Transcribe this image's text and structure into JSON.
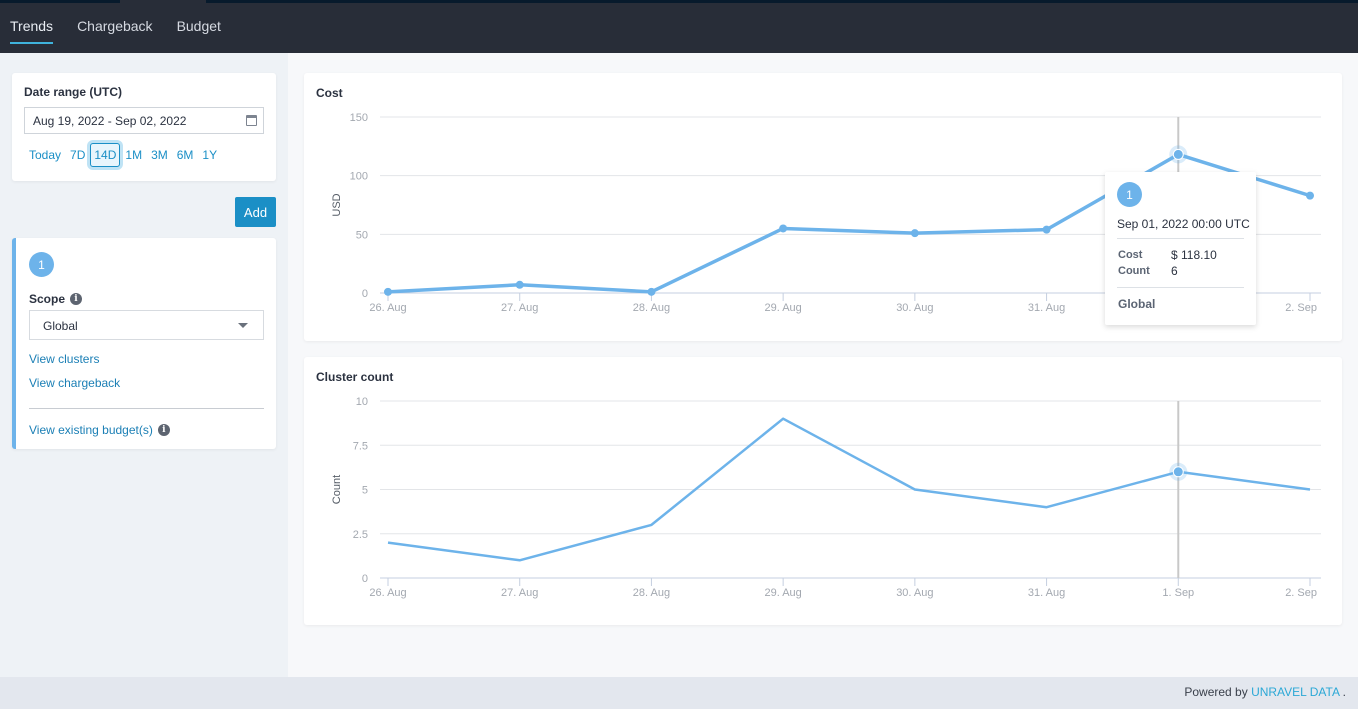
{
  "nav": {
    "tabs": [
      {
        "label": "Trends",
        "active": true
      },
      {
        "label": "Chargeback",
        "active": false
      },
      {
        "label": "Budget",
        "active": false
      }
    ]
  },
  "date_range": {
    "label": "Date range (UTC)",
    "value": "Aug 19, 2022 - Sep 02, 2022",
    "icon": "calendar-icon",
    "quick_ranges": [
      "Today",
      "7D",
      "14D",
      "1M",
      "3M",
      "6M",
      "1Y"
    ],
    "selected_range": "14D"
  },
  "add_button": {
    "label": "Add"
  },
  "scope_card": {
    "number": "1",
    "scope_label": "Scope",
    "scope_value": "Global",
    "links": {
      "view_clusters": "View clusters",
      "view_chargeback": "View chargeback",
      "view_budgets": "View existing budget(s)"
    }
  },
  "tooltip": {
    "number": "1",
    "date": "Sep 01, 2022 00:00 UTC",
    "rows": [
      {
        "key": "Cost",
        "value": "$ 118.10"
      },
      {
        "key": "Count",
        "value": "6"
      }
    ],
    "scope": "Global"
  },
  "footer": {
    "powered_by": "Powered by",
    "brand": "UNRAVEL DATA",
    "suffix": "."
  },
  "colors": {
    "accent": "#1b8fc6",
    "series": "#6db3ea",
    "nav_bg": "#282d38",
    "tab_underline": "#3fb3dc"
  },
  "chart_data": [
    {
      "type": "line",
      "title": "Cost",
      "xlabel": "",
      "ylabel": "USD",
      "categories": [
        "26. Aug",
        "27. Aug",
        "28. Aug",
        "29. Aug",
        "30. Aug",
        "31. Aug",
        "1. Sep",
        "2. Sep"
      ],
      "yticks": [
        "0",
        "50",
        "100",
        "150"
      ],
      "ylim": [
        0,
        150
      ],
      "series": [
        {
          "name": "Cost",
          "values": [
            1,
            7,
            1,
            55,
            51,
            54,
            118.1,
            83
          ]
        }
      ],
      "highlight_index": 6,
      "markers": true,
      "grid": true
    },
    {
      "type": "line",
      "title": "Cluster count",
      "xlabel": "",
      "ylabel": "Count",
      "categories": [
        "26. Aug",
        "27. Aug",
        "28. Aug",
        "29. Aug",
        "30. Aug",
        "31. Aug",
        "1. Sep",
        "2. Sep"
      ],
      "yticks": [
        "0",
        "2.5",
        "5",
        "7.5",
        "10"
      ],
      "ylim": [
        0,
        10
      ],
      "series": [
        {
          "name": "Count",
          "values": [
            2,
            1,
            3,
            9,
            5,
            4,
            6,
            5
          ]
        }
      ],
      "highlight_index": 6,
      "markers": false,
      "grid": true
    }
  ]
}
